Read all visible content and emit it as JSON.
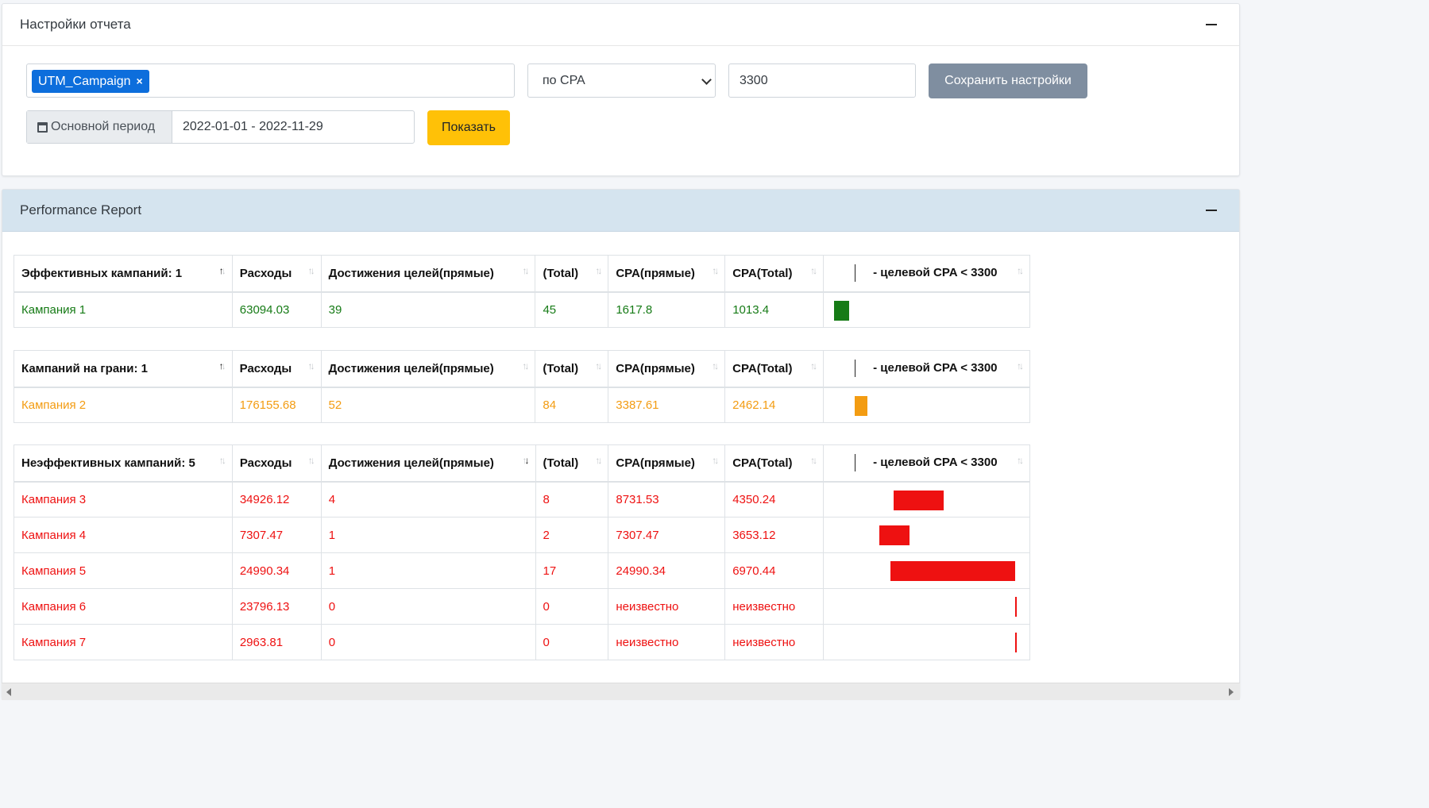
{
  "settings": {
    "title": "Настройки отчета",
    "tag": "UTM_Campaign",
    "metric_select": "по CPA",
    "target_value": "3300",
    "save_label": "Сохранить настройки",
    "period_label": "Основной период",
    "period_value": "2022-01-01 - 2022-11-29",
    "show_label": "Показать"
  },
  "report": {
    "title": "Performance Report",
    "headers": [
      "Расходы",
      "Достижения целей(прямые)",
      "(Total)",
      "CPA(прямые)",
      "CPA(Total)",
      "- целевой CPA < 3300"
    ],
    "effective": {
      "title": "Эффективных кампаний: 1",
      "color": "#167b16",
      "rows": [
        {
          "name": "Кампания 1",
          "spend": "63094.03",
          "goals": "39",
          "total": "45",
          "cpa": "1617.8",
          "cpa_total": "1013.4",
          "bar_value": 1013.4
        }
      ]
    },
    "edge": {
      "title": "Кампаний на грани: 1",
      "color": "#f39c12",
      "rows": [
        {
          "name": "Кампания 2",
          "spend": "176155.68",
          "goals": "52",
          "total": "84",
          "cpa": "3387.61",
          "cpa_total": "2462.14",
          "bar_value": 2462.14
        }
      ]
    },
    "ineffective": {
      "title": "Неэффективных кампаний: 5",
      "color": "#ee1111",
      "rows": [
        {
          "name": "Кампания 3",
          "spend": "34926.12",
          "goals": "4",
          "total": "8",
          "cpa": "8731.53",
          "cpa_total": "4350.24",
          "bar_value": 4350.24
        },
        {
          "name": "Кампания 4",
          "spend": "7307.47",
          "goals": "1",
          "total": "2",
          "cpa": "7307.47",
          "cpa_total": "3653.12",
          "bar_value": 3653.12
        },
        {
          "name": "Кампания 5",
          "spend": "24990.34",
          "goals": "1",
          "total": "17",
          "cpa": "24990.34",
          "cpa_total": "6970.44",
          "bar_value": 6970.44
        },
        {
          "name": "Кампания 6",
          "spend": "23796.13",
          "goals": "0",
          "total": "0",
          "cpa": "неизвестно",
          "cpa_total": "неизвестно",
          "bar_value": null
        },
        {
          "name": "Кампания 7",
          "spend": "2963.81",
          "goals": "0",
          "total": "0",
          "cpa": "неизвестно",
          "cpa_total": "неизвестно",
          "bar_value": null
        }
      ]
    }
  }
}
